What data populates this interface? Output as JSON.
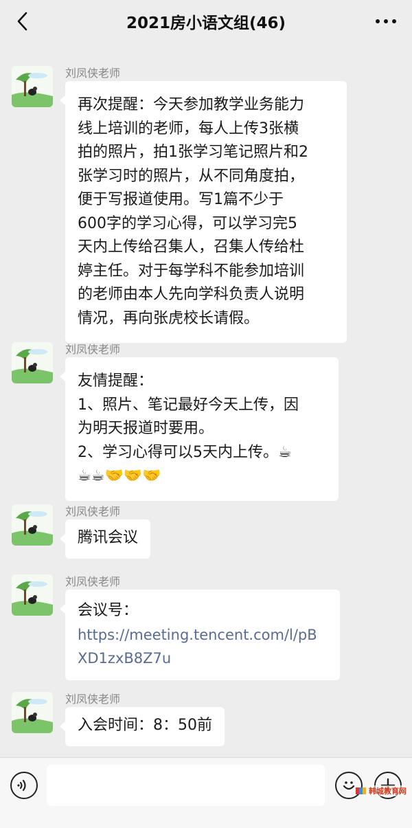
{
  "header": {
    "title": "2021房小语文组(46)"
  },
  "messages": [
    {
      "sender": "刘凤侠老师",
      "lines": [
        "再次提醒：今天参加教学业务能力",
        "线上培训的老师，每人上传3张横",
        "拍的照片，拍1张学习笔记照片和2",
        "张学习时的照片，从不同角度拍，",
        "便于写报道使用。写1篇不少于",
        "600字的学习心得，可以学习完5",
        "天内上传给召集人，召集人传给杜",
        "婷主任。对于每学科不能参加培训",
        "的老师由本人先向学科负责人说明",
        "情况，再向张虎校长请假。"
      ]
    },
    {
      "sender": "刘凤侠老师",
      "lines": [
        "友情提醒：",
        "1、照片、笔记最好今天上传，因",
        "为明天报道时要用。",
        "2、学习心得可以5天内上传。☕",
        "☕☕🤝🤝🤝"
      ]
    },
    {
      "sender": "刘凤侠老师",
      "lines": [
        "腾讯会议"
      ]
    },
    {
      "sender": "刘凤侠老师",
      "label": "会议号：",
      "link_lines": [
        "https://meeting.tencent.com/l/pB",
        "XD1zxB8Z7u"
      ]
    },
    {
      "sender": "刘凤侠老师",
      "lines": [
        "入会时间：8：50前"
      ]
    }
  ],
  "watermark": {
    "text": "韩城教育网"
  },
  "icons": {
    "back": "chevron-left-icon",
    "more": "more-dots-icon",
    "voice": "voice-icon",
    "emoji": "emoji-icon",
    "plus": "plus-icon"
  },
  "colors": {
    "background": "#ededed",
    "bubble": "#ffffff",
    "link": "#576b95",
    "sender": "#888888"
  }
}
